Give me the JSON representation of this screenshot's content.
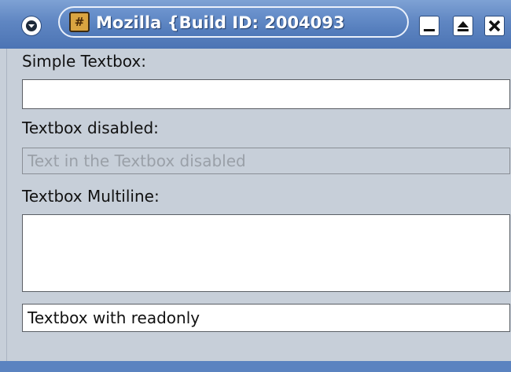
{
  "window": {
    "title": "Mozilla {Build ID: 2004093",
    "app_icon": "mozilla-app-icon",
    "controls": [
      "menu-down-icon",
      "minimize-icon",
      "maximize-icon",
      "close-icon"
    ]
  },
  "form": {
    "simple": {
      "label": "Simple Textbox:",
      "value": ""
    },
    "disabled": {
      "label": "Textbox disabled:",
      "value": "Text in the Textbox disabled"
    },
    "multiline": {
      "label": "Textbox Multiline:",
      "value": ""
    },
    "readonly": {
      "value": "Textbox with readonly"
    }
  },
  "colors": {
    "titlebar": "#5f86c2",
    "background": "#c7cfd9",
    "field_border": "#5a5e64"
  }
}
